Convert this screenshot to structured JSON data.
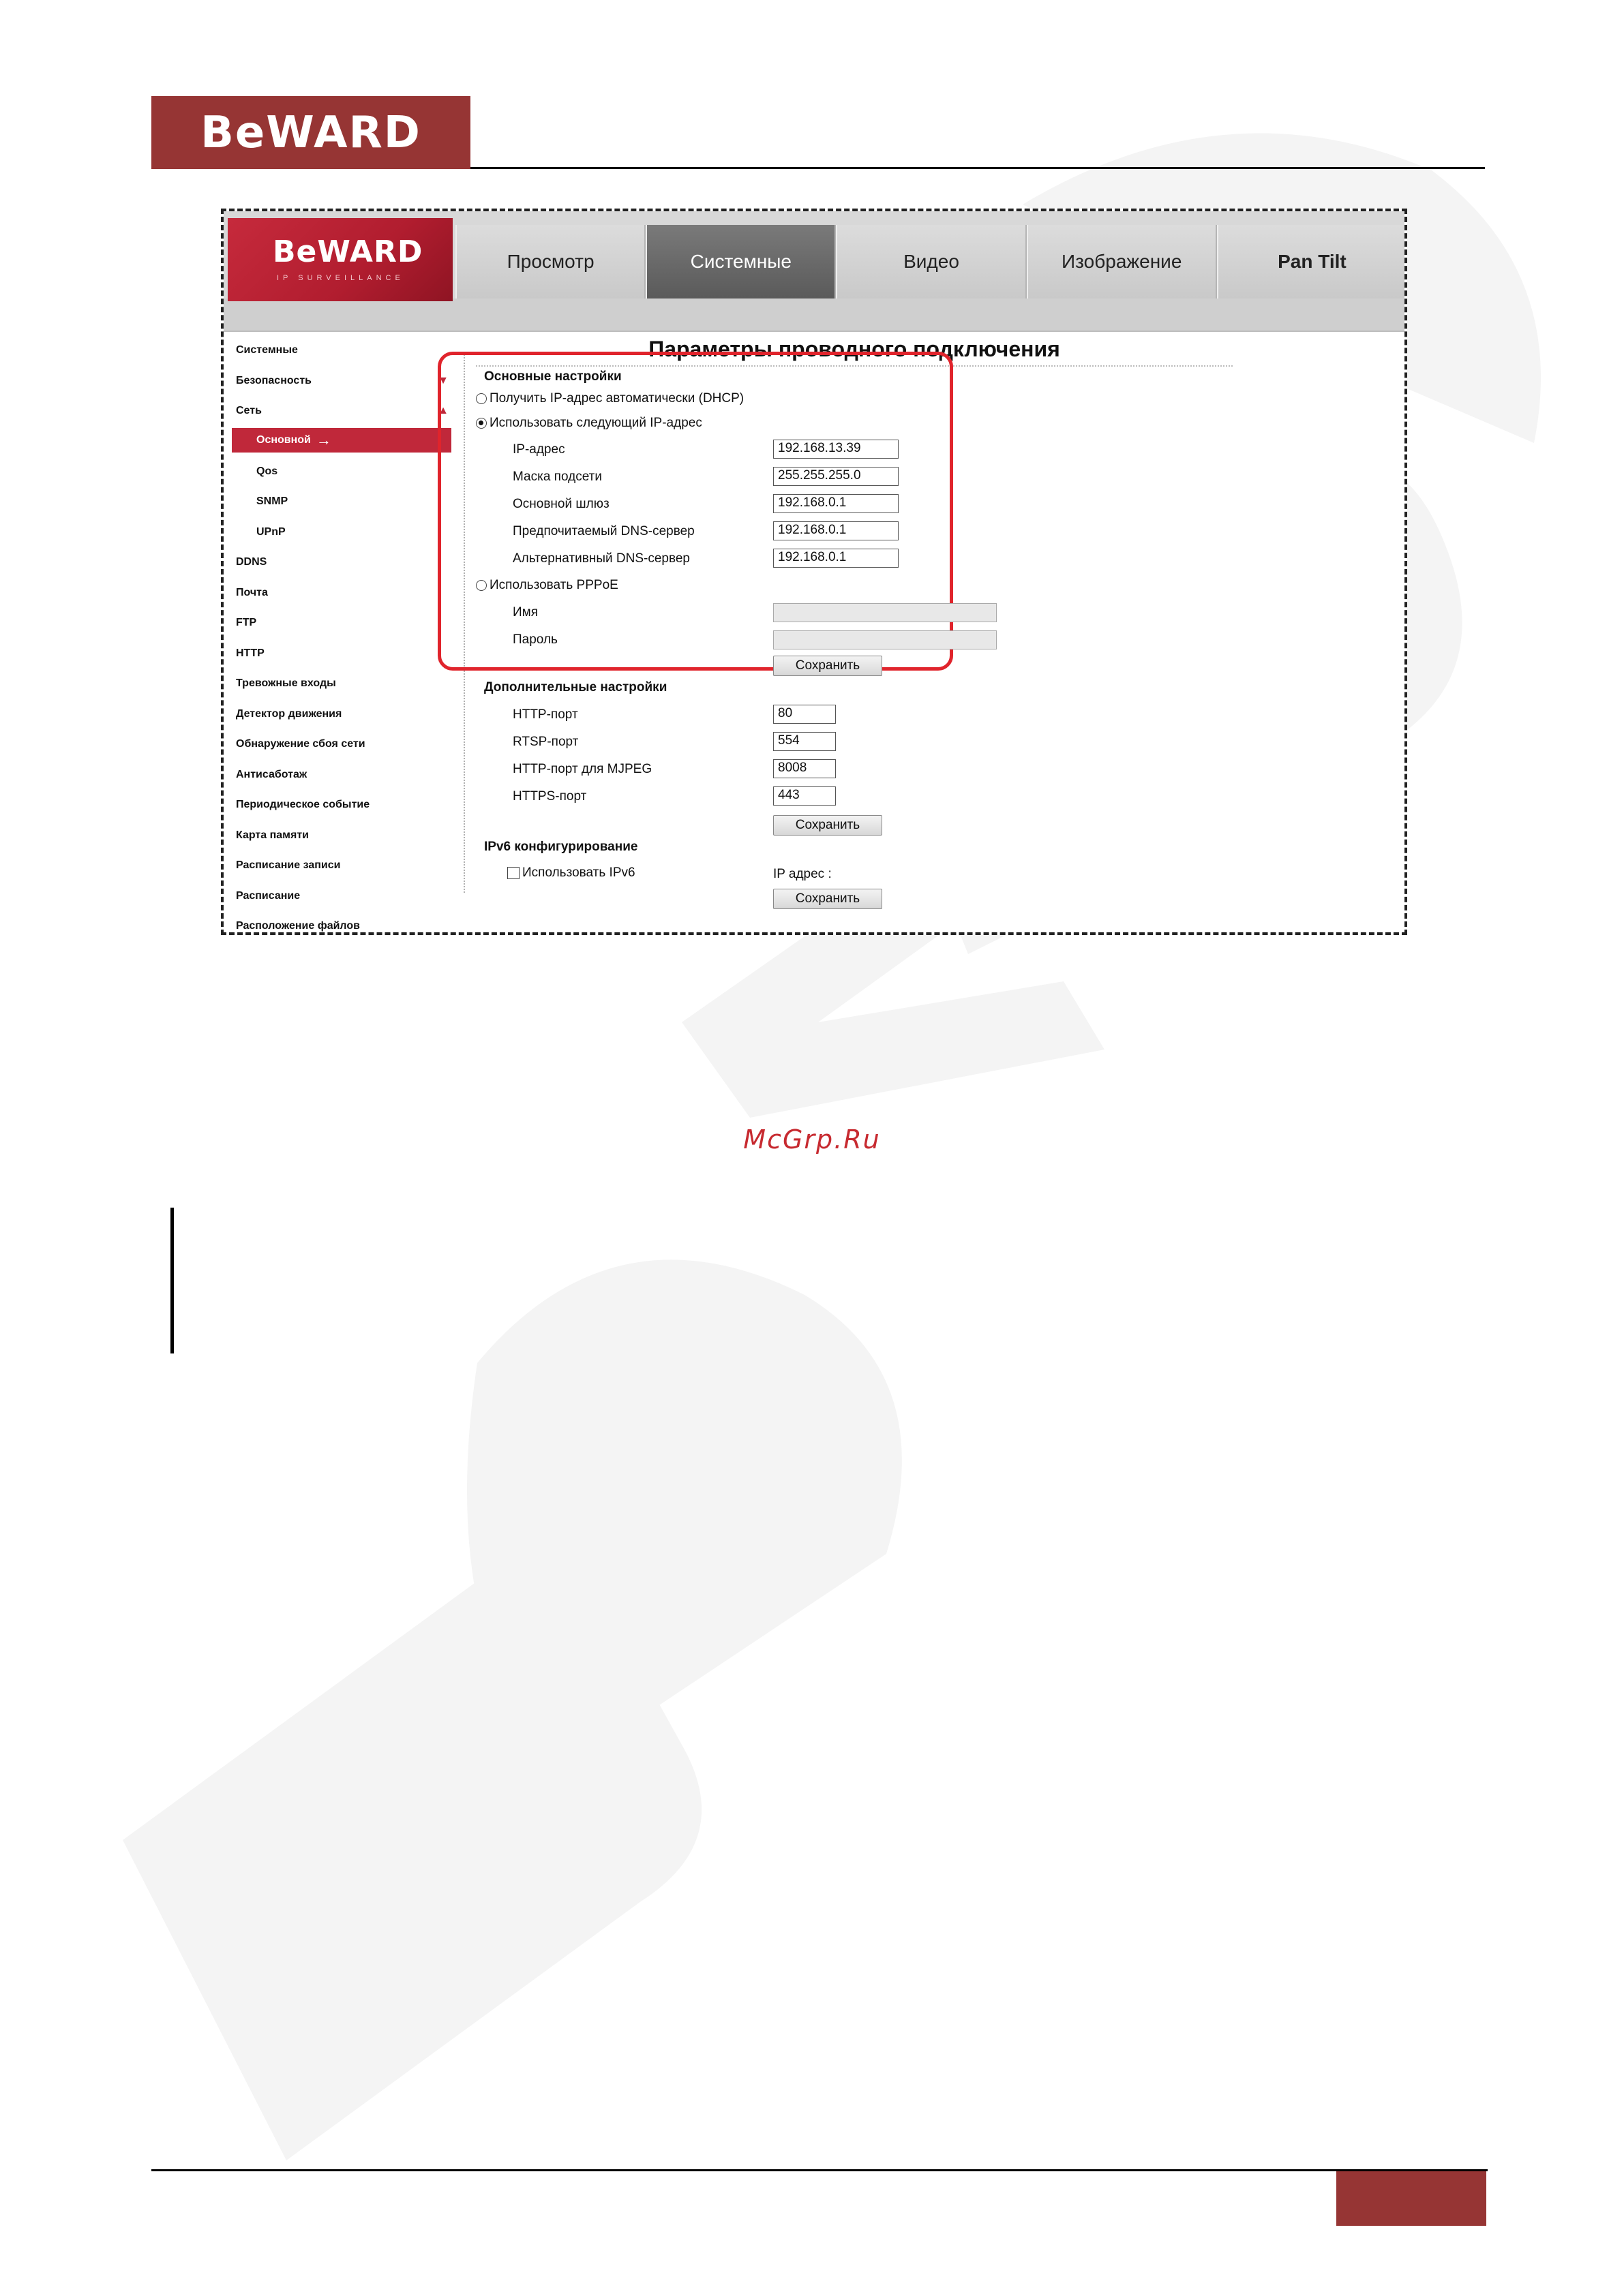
{
  "document": {
    "brand": "BeWARD",
    "source_mark": "McGrp.Ru",
    "colors": {
      "brand": "#963534",
      "ui_accent": "#c0283a",
      "highlight": "#e0242c"
    }
  },
  "ui": {
    "logo": {
      "brand": "BeWARD",
      "tagline": "IP SURVEILLANCE"
    },
    "tabs": [
      "Просмотр",
      "Системные",
      "Видео",
      "Изображение",
      "Pan Tilt"
    ],
    "active_tab": "Системные",
    "sidebar": [
      {
        "label": "Системные"
      },
      {
        "label": "Безопасность",
        "arrow": "▼"
      },
      {
        "label": "Сеть",
        "arrow": "▲"
      },
      {
        "label": "Основной",
        "active": true,
        "sub": true,
        "suffix": "→"
      },
      {
        "label": "Qos",
        "sub": true
      },
      {
        "label": "SNMP",
        "sub": true
      },
      {
        "label": "UPnP",
        "sub": true
      },
      {
        "label": "DDNS"
      },
      {
        "label": "Почта"
      },
      {
        "label": "FTP"
      },
      {
        "label": "HTTP"
      },
      {
        "label": "Тревожные входы"
      },
      {
        "label": "Детектор движения"
      },
      {
        "label": "Обнаружение сбоя сети"
      },
      {
        "label": "Антисаботаж"
      },
      {
        "label": "Периодическое событие"
      },
      {
        "label": "Карта памяти"
      },
      {
        "label": "Расписание записи"
      },
      {
        "label": "Расписание"
      },
      {
        "label": "Расположение файлов"
      }
    ],
    "page_title": "Параметры проводного подключения",
    "basic": {
      "title": "Основные настройки",
      "dhcp_label": "Получить IP-адрес автоматически (DHCP)",
      "static_label": "Использовать следующий IP-адрес",
      "ip_label": "IP-адрес",
      "ip_value": "192.168.13.39",
      "mask_label": "Маска подсети",
      "mask_value": "255.255.255.0",
      "gateway_label": "Основной шлюз",
      "gateway_value": "192.168.0.1",
      "dns1_label": "Предпочитаемый DNS-сервер",
      "dns1_value": "192.168.0.1",
      "dns2_label": "Альтернативный DNS-сервер",
      "dns2_value": "192.168.0.1",
      "pppoe_label": "Использовать PPPoE",
      "name_label": "Имя",
      "password_label": "Пароль",
      "save": "Сохранить"
    },
    "extra": {
      "title": "Дополнительные настройки",
      "http_label": "HTTP-порт",
      "http_value": "80",
      "rtsp_label": "RTSP-порт",
      "rtsp_value": "554",
      "mjpeg_label": "HTTP-порт для MJPEG",
      "mjpeg_value": "8008",
      "https_label": "HTTPS-порт",
      "https_value": "443",
      "save": "Сохранить"
    },
    "ipv6": {
      "title": "IPv6 конфигурирование",
      "use_label": "Использовать IPv6",
      "address_label": "IP адрес :",
      "save": "Сохранить"
    }
  }
}
